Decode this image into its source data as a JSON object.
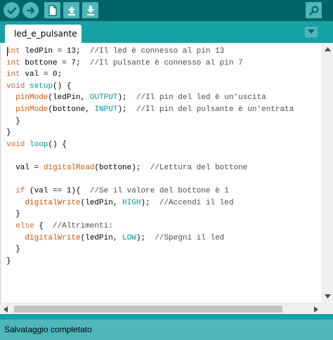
{
  "toolbar": {
    "buttons": [
      {
        "name": "verify-button",
        "icon": "checkmark-icon"
      },
      {
        "name": "upload-button",
        "icon": "arrow-right-icon"
      },
      {
        "name": "new-button",
        "icon": "new-file-icon"
      },
      {
        "name": "open-button",
        "icon": "arrow-up-icon"
      },
      {
        "name": "save-button",
        "icon": "arrow-down-icon"
      },
      {
        "name": "serial-monitor-button",
        "icon": "magnifier-icon"
      }
    ]
  },
  "tab": {
    "label": "led_e_pulsante"
  },
  "editor": {
    "lines": [
      [
        [
          "kw",
          "int"
        ],
        [
          "",
          "ledPin = 13;  "
        ],
        [
          "cm",
          "//Il led è connesso al pin 13"
        ]
      ],
      [
        [
          "kw",
          "int"
        ],
        [
          "",
          "bottone = 7;  "
        ],
        [
          "cm",
          "//Il pulsante è connesso al pin 7"
        ]
      ],
      [
        [
          "kw",
          "int"
        ],
        [
          "",
          "val = 0;"
        ]
      ],
      [
        [
          "kw",
          "void"
        ],
        [
          "",
          ""
        ],
        [
          "kwb",
          "setup"
        ],
        [
          "",
          "() {"
        ]
      ],
      [
        [
          "",
          "  "
        ],
        [
          "fn",
          "pinMode"
        ],
        [
          "",
          "(ledPin, "
        ],
        [
          "cst",
          "OUTPUT"
        ],
        [
          "",
          "); "
        ],
        [
          "cm",
          " //Il pin del led è un'uscita"
        ]
      ],
      [
        [
          "",
          "  "
        ],
        [
          "fn",
          "pinMode"
        ],
        [
          "",
          "(bottone, "
        ],
        [
          "cst",
          "INPUT"
        ],
        [
          "",
          "); "
        ],
        [
          "cm",
          " //Il pin del pulsante è un'entrata"
        ]
      ],
      [
        [
          "",
          "  }"
        ]
      ],
      [
        [
          "",
          "}"
        ]
      ],
      [
        [
          "kw",
          "void"
        ],
        [
          "",
          ""
        ],
        [
          "kwb",
          "loop"
        ],
        [
          "",
          "() {"
        ]
      ],
      [
        [
          "",
          ""
        ]
      ],
      [
        [
          "",
          "  val = "
        ],
        [
          "fn",
          "digitalRead"
        ],
        [
          "",
          "(bottone);  "
        ],
        [
          "cm",
          "//Lettura del bottone"
        ]
      ],
      [
        [
          "",
          ""
        ]
      ],
      [
        [
          "",
          "  "
        ],
        [
          "kw",
          "if"
        ],
        [
          "",
          "(val == 1){  "
        ],
        [
          "cm",
          "//Se il valore del bottone è 1"
        ]
      ],
      [
        [
          "",
          "    "
        ],
        [
          "fn",
          "digitalWrite"
        ],
        [
          "",
          "(ledPin, "
        ],
        [
          "cst",
          "HIGH"
        ],
        [
          "",
          ");  "
        ],
        [
          "cm",
          "//Accendi il led"
        ]
      ],
      [
        [
          "",
          "  }"
        ]
      ],
      [
        [
          "",
          "  "
        ],
        [
          "kw",
          "else"
        ],
        [
          "",
          "{  "
        ],
        [
          "cm",
          "//Altrimenti:"
        ]
      ],
      [
        [
          "",
          "    "
        ],
        [
          "fn",
          "digitalWrite"
        ],
        [
          "",
          "(ledPin, "
        ],
        [
          "cst",
          "LOW"
        ],
        [
          "",
          ");  "
        ],
        [
          "cm",
          "//Spegni il led"
        ]
      ],
      [
        [
          "",
          "  }"
        ]
      ],
      [
        [
          "",
          "}"
        ]
      ]
    ]
  },
  "status": {
    "message": "Salvataggio completato"
  },
  "colors": {
    "toolbar_bg": "#006468",
    "tabbar_bg": "#17a1a5",
    "button_bg": "#4db7bb",
    "status_bg": "#4db7bb",
    "keyword": "#cc6633",
    "function": "#d35400",
    "constant": "#00979c",
    "comment": "#434f54"
  }
}
